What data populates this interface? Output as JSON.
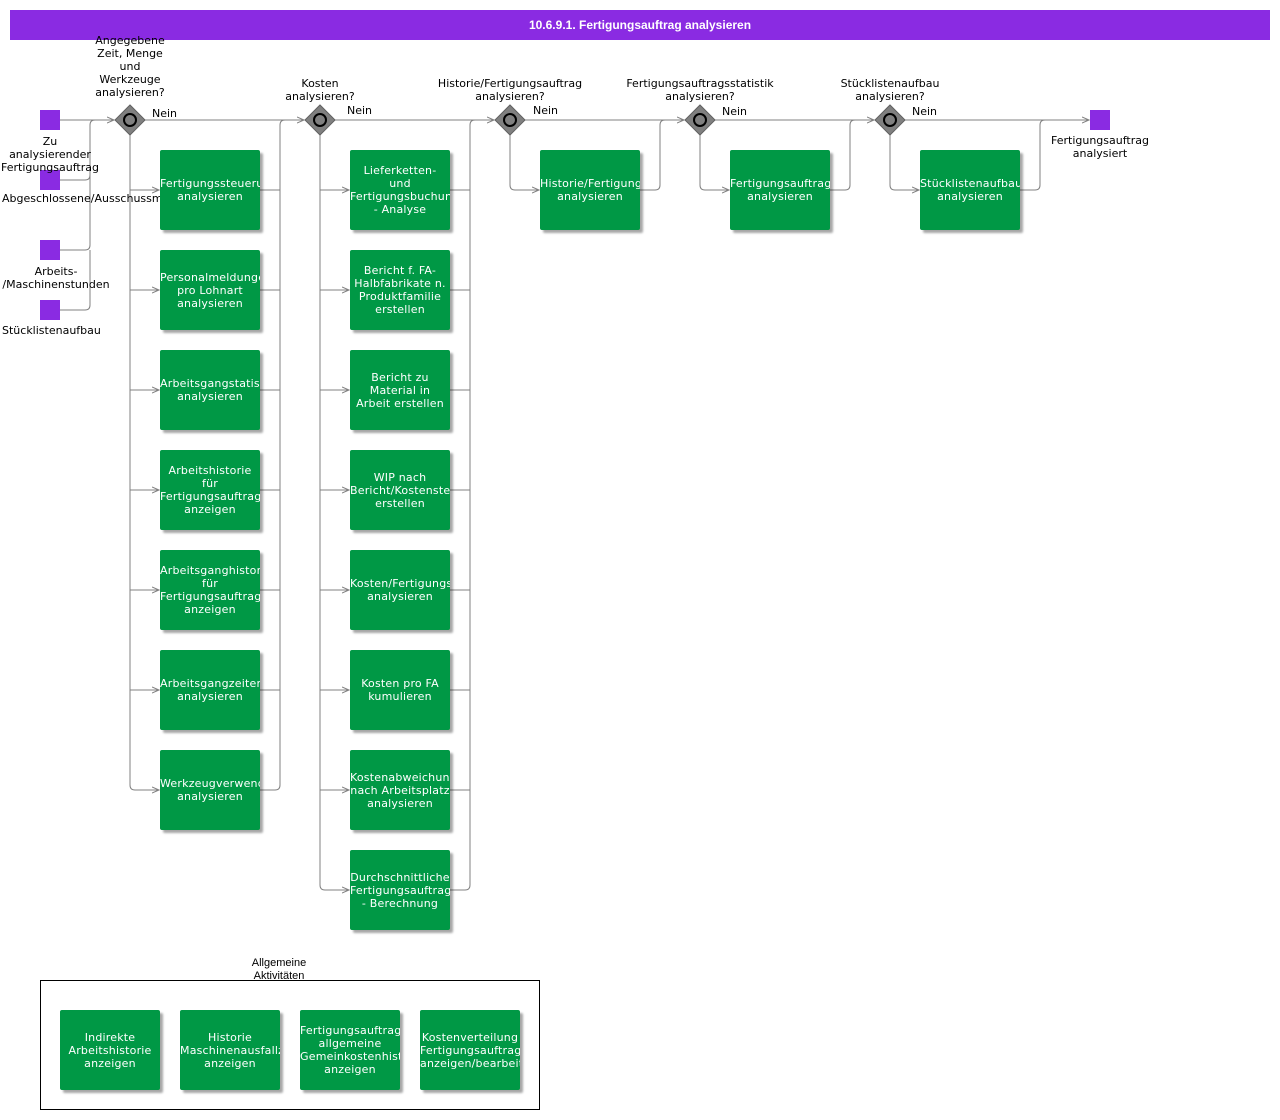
{
  "title": "10.6.9.1. Fertigungsauftrag analysieren",
  "colors": {
    "title_bar": "#8a2be2",
    "event": "#8a2be2",
    "activity": "#009845",
    "gateway": "#808080",
    "connector": "#808080"
  },
  "gateways": [
    {
      "question": "Angegebene\nZeit, Menge\nund\nWerkzeuge\nanalysieren?",
      "no_label": "Nein"
    },
    {
      "question": "Kosten\nanalysieren?",
      "no_label": "Nein"
    },
    {
      "question": "Historie/Fertigungsauftrag\nanalysieren?",
      "no_label": "Nein"
    },
    {
      "question": "Fertigungsauftragsstatistik\nanalysieren?",
      "no_label": "Nein"
    },
    {
      "question": "Stücklistenaufbau\nanalysieren?",
      "no_label": "Nein"
    }
  ],
  "start_events": [
    {
      "label": "Zu\nanalysierender\nFertigungsauftrag"
    },
    {
      "label": "Abgeschlossene/Ausschussmengen"
    },
    {
      "label": "Arbeits-\n/Maschinenstunden"
    },
    {
      "label": "Stücklistenaufbau"
    }
  ],
  "end_event": {
    "label": "Fertigungsauftrag\nanalysiert"
  },
  "column1": [
    {
      "label": "Fertigungssteuerungsberichte\nanalysieren"
    },
    {
      "label": "Personalmeldungen\npro Lohnart\nanalysieren"
    },
    {
      "label": "Arbeitsgangstatistik\nanalysieren"
    },
    {
      "label": "Arbeitshistorie\nfür\nFertigungsauftrag\nanzeigen"
    },
    {
      "label": "Arbeitsganghistorie\nfür\nFertigungsauftrag\nanzeigen"
    },
    {
      "label": "Arbeitsgangzeiterfassung\nanalysieren"
    },
    {
      "label": "Werkzeugverwendung\nanalysieren"
    }
  ],
  "column2": [
    {
      "label": "Lieferketten-\nund\nFertigungsbuchungen\n- Analyse"
    },
    {
      "label": "Bericht f. FA-\nHalbfabrikate n.\nProduktfamilie\nerstellen"
    },
    {
      "label": "Bericht zu\nMaterial in\nArbeit erstellen"
    },
    {
      "label": "WIP nach\nBericht/Kostenstelle\nerstellen"
    },
    {
      "label": "Kosten/Fertigungsauftrag\nanalysieren"
    },
    {
      "label": "Kosten pro FA\nkumulieren"
    },
    {
      "label": "Kostenabweichungen\nnach Arbeitsplatz\nanalysieren"
    },
    {
      "label": "Durchschnittliche\nFertigungsauftragskosten\n- Berechnung"
    }
  ],
  "single_activities": [
    {
      "label": "Historie/Fertigungsauftrag\nanalysieren"
    },
    {
      "label": "Fertigungsauftragsstatistik\nanalysieren"
    },
    {
      "label": "Stücklistenaufbau\nanalysieren"
    }
  ],
  "general_group": {
    "title": "Allgemeine\nAktivitäten",
    "items": [
      {
        "label": "Indirekte\nArbeitshistorie\nanzeigen"
      },
      {
        "label": "Historie\nMaschinenausfallzeiten\nanzeigen"
      },
      {
        "label": "Fertigungsauftrag\nallgemeine\nGemeinkostenhistorie\nanzeigen"
      },
      {
        "label": "Kostenverteilung\nFertigungsauftragskomponente\nanzeigen/bearbeiten"
      }
    ]
  }
}
